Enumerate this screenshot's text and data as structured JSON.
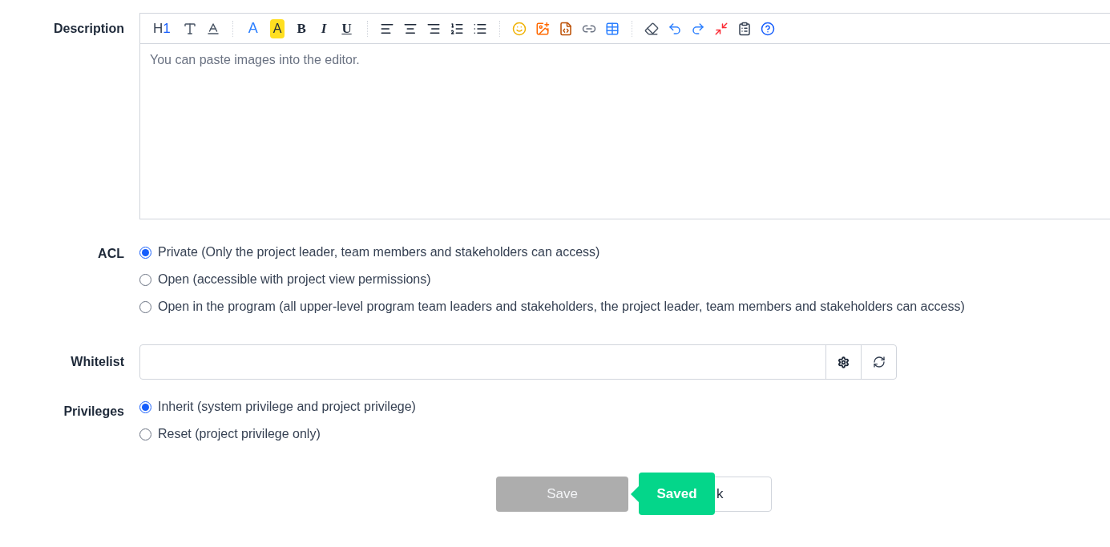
{
  "description": {
    "label": "Description",
    "placeholder": "You can paste images into the editor.",
    "toolbar": [
      {
        "kind": "heading",
        "label": "H",
        "sub": "1"
      },
      {
        "kind": "font"
      },
      {
        "kind": "size"
      },
      {
        "kind": "sep"
      },
      {
        "kind": "color",
        "label": "A"
      },
      {
        "kind": "highlight",
        "label": "A"
      },
      {
        "kind": "bold",
        "label": "B"
      },
      {
        "kind": "italic",
        "label": "I"
      },
      {
        "kind": "underline",
        "label": "U"
      },
      {
        "kind": "sep"
      },
      {
        "kind": "align-left"
      },
      {
        "kind": "align-center"
      },
      {
        "kind": "align-right"
      },
      {
        "kind": "ordered-list"
      },
      {
        "kind": "bullet-list"
      },
      {
        "kind": "sep"
      },
      {
        "kind": "emoji"
      },
      {
        "kind": "image"
      },
      {
        "kind": "code"
      },
      {
        "kind": "link"
      },
      {
        "kind": "table"
      },
      {
        "kind": "sep"
      },
      {
        "kind": "eraser"
      },
      {
        "kind": "undo"
      },
      {
        "kind": "redo"
      },
      {
        "kind": "fullscreen"
      },
      {
        "kind": "paste"
      },
      {
        "kind": "help"
      }
    ]
  },
  "acl": {
    "label": "ACL",
    "options": [
      {
        "label": "Private (Only the project leader, team members and stakeholders can access)",
        "selected": true
      },
      {
        "label": "Open (accessible with project view permissions)",
        "selected": false
      },
      {
        "label": "Open in the program (all upper-level program team leaders and stakeholders, the project leader, team members and stakeholders can access)",
        "selected": false
      }
    ]
  },
  "whitelist": {
    "label": "Whitelist"
  },
  "privileges": {
    "label": "Privileges",
    "options": [
      {
        "label": "Inherit (system privilege and project privilege)",
        "selected": true
      },
      {
        "label": "Reset (project privilege only)",
        "selected": false
      }
    ]
  },
  "save_button": {
    "label": "Save",
    "disabled": true
  },
  "back_button": {
    "label": "k"
  },
  "tooltip": {
    "label": "Saved"
  }
}
